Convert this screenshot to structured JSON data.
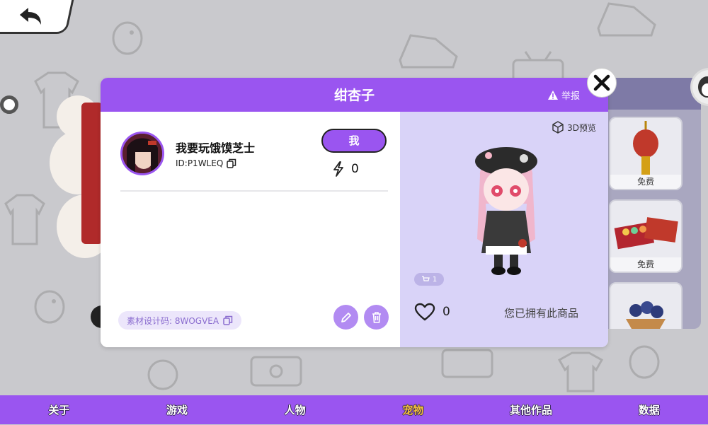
{
  "modal": {
    "title": "绀杏子",
    "report_label": "举报",
    "user": {
      "name": "我要玩饿馍芝士",
      "id": "ID:P1WLEQ"
    },
    "me_button": "我",
    "energy_count": "0",
    "design_code": "素材设计码: 8WOGVEA",
    "preview_3d": "3D预览",
    "cart_count": "1",
    "like_count": "0",
    "owned_text": "您已拥有此商品"
  },
  "shop": {
    "items": [
      {
        "price": "免费",
        "icon": "lantern"
      },
      {
        "price": "免费",
        "icon": "gift-box"
      },
      {
        "price": "",
        "icon": "blueberry-basket"
      }
    ]
  },
  "nav": {
    "items": [
      {
        "label": "关于",
        "active": false
      },
      {
        "label": "游戏",
        "active": false
      },
      {
        "label": "人物",
        "active": false
      },
      {
        "label": "宠物",
        "active": true
      },
      {
        "label": "其他作品",
        "active": false
      },
      {
        "label": "数据",
        "active": false
      }
    ]
  },
  "colors": {
    "accent": "#9a55f0",
    "nav_active": "#f6c23b",
    "preview_bg": "#d9d3f8"
  }
}
